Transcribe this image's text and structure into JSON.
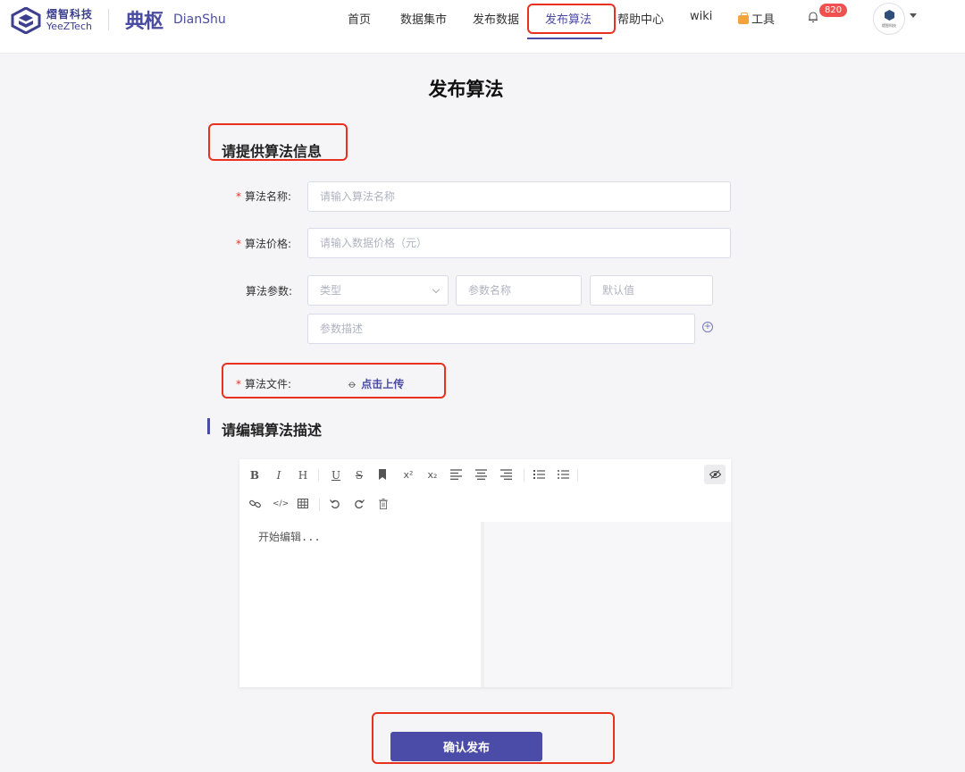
{
  "header": {
    "logo_yeez_cn": "熠智科技",
    "logo_yeez_en": "YeeZTech",
    "logo_dian_cn": "典枢",
    "logo_dian_en": "DianShu",
    "nav": [
      {
        "label": "首页"
      },
      {
        "label": "数据集市"
      },
      {
        "label": "发布数据"
      },
      {
        "label": "发布算法",
        "active": true
      },
      {
        "label": "帮助中心"
      },
      {
        "label": "wiki"
      },
      {
        "label": "工具"
      }
    ],
    "notification_count": "820",
    "avatar_label": "熠智科技",
    "accent_color": "#4a4ca3",
    "badge_color": "#f0504f"
  },
  "page": {
    "title": "发布算法",
    "section1_title": "请提供算法信息",
    "section2_title": "请编辑算法描述"
  },
  "form": {
    "name_label": "算法名称:",
    "name_placeholder": "请输入算法名称",
    "price_label": "算法价格:",
    "price_placeholder": "请输入数据价格（元）",
    "params_label": "算法参数:",
    "param_type_placeholder": "类型",
    "param_name_placeholder": "参数名称",
    "param_default_placeholder": "默认值",
    "param_desc_placeholder": "参数描述",
    "file_label": "算法文件:",
    "upload_label": "点击上传",
    "required_mark": "*"
  },
  "editor": {
    "toolbar_row1": [
      "B",
      "I",
      "H",
      "U",
      "S",
      "bookmark",
      "x²",
      "x₂",
      "align-left",
      "align-center",
      "align-right",
      "ordered-list",
      "unordered-list"
    ],
    "toolbar_row2": [
      "link",
      "code",
      "table",
      "undo",
      "redo",
      "trash"
    ],
    "placeholder": "开始编辑..."
  },
  "submit_label": "确认发布",
  "highlight_color": "#e8321f"
}
